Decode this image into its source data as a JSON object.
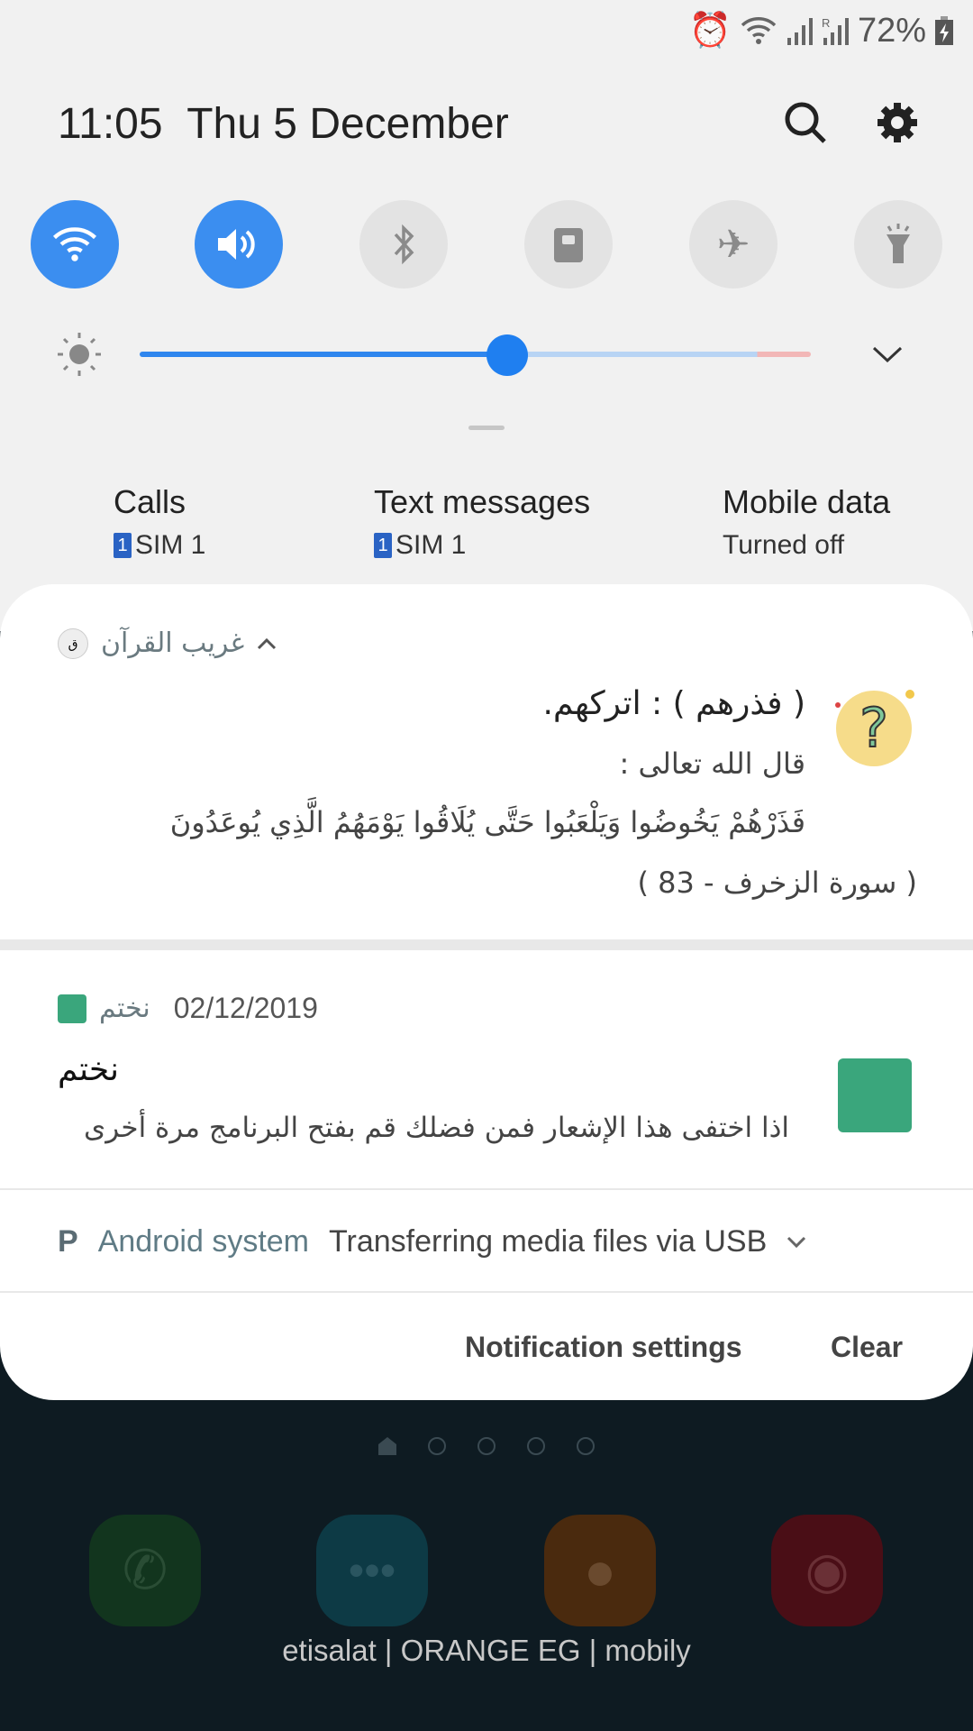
{
  "status_bar": {
    "battery": "72%",
    "icons": [
      "alarm-icon",
      "wifi-icon",
      "signal-icon",
      "roaming-signal-icon",
      "battery-charging-icon"
    ]
  },
  "header": {
    "time": "11:05",
    "date": "Thu 5 December"
  },
  "quick_toggles": [
    {
      "name": "wifi",
      "on": true
    },
    {
      "name": "sound",
      "on": true
    },
    {
      "name": "bluetooth",
      "on": false
    },
    {
      "name": "rotation-lock",
      "on": false
    },
    {
      "name": "airplane",
      "on": false
    },
    {
      "name": "flashlight",
      "on": false
    }
  ],
  "brightness": {
    "level": 0.55
  },
  "sim": [
    {
      "title": "Calls",
      "sim": "SIM 1",
      "badge": "1"
    },
    {
      "title": "Text messages",
      "sim": "SIM 1",
      "badge": "1"
    },
    {
      "title": "Mobile data",
      "sub": "Turned off"
    }
  ],
  "notif1": {
    "app": "غريب القرآن",
    "title": "( فذرهم )  :  اتركهم.",
    "line1": "قال الله تعالى :",
    "line2": "فَذَرْهُمْ يَخُوضُوا وَيَلْعَبُوا حَتَّى يُلَاقُوا يَوْمَهُمُ الَّذِي يُوعَدُونَ",
    "line3": "( سورة الزخرف - 83 )"
  },
  "notif2": {
    "app": "نختم",
    "date": "02/12/2019",
    "title": "نختم",
    "body": "اذا اختفى هذا الإشعار فمن فضلك قم بفتح البرنامج مرة أخرى"
  },
  "notif3": {
    "app": "Android system",
    "text": "Transferring media files via USB"
  },
  "actions": {
    "settings": "Notification settings",
    "clear": "Clear"
  },
  "carrier": "etisalat | ORANGE EG | mobily"
}
